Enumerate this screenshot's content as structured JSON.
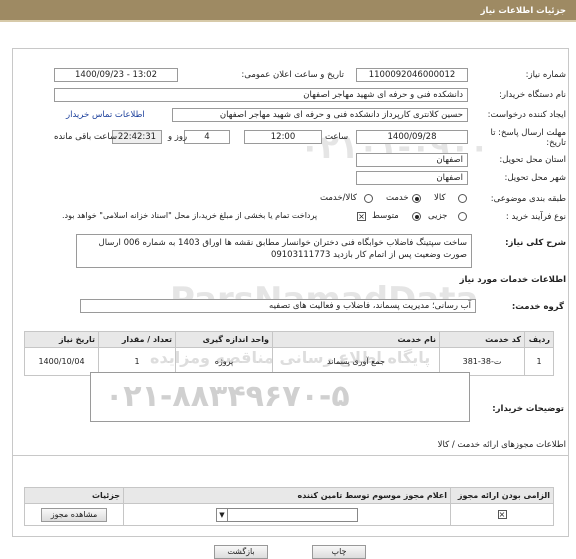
{
  "header": {
    "title": "جزئیات اطلاعات نیاز"
  },
  "need_number": {
    "label": "شماره نیاز:",
    "value": "1100092046000012"
  },
  "announce_datetime": {
    "label": "تاریخ و ساعت اعلان عمومی:",
    "value": "1400/09/23 - 13:02"
  },
  "buyer_org": {
    "label": "نام دستگاه خریدار:",
    "value": "دانشکده فنی و حرفه ای شهید مهاجر اصفهان"
  },
  "requester": {
    "label": "ایجاد کننده درخواست:",
    "value": "حسین کلانتری کارپرداز دانشکده فنی و حرفه ای شهید مهاجر اصفهان",
    "contact_link": "اطلاعات تماس خریدار"
  },
  "deadline": {
    "label": "مهلت ارسال پاسخ: تا تاریخ:",
    "date": "1400/09/28",
    "time_label": "ساعت",
    "time": "12:00",
    "days": "4",
    "days_label": "روز و",
    "remaining": "22:42:31",
    "remaining_label": "ساعت باقی مانده"
  },
  "province": {
    "label": "استان محل تحویل:",
    "value": "اصفهان"
  },
  "city": {
    "label": "شهر محل تحویل:",
    "value": "اصفهان"
  },
  "category": {
    "label": "طبقه بندی موضوعی:",
    "options": [
      "کالا",
      "خدمت",
      "کالا/خدمت"
    ],
    "selected": "خدمت"
  },
  "process": {
    "label": "نوع فرآیند خرید :",
    "options": [
      "جزیی",
      "متوسط"
    ],
    "selected": "متوسط",
    "treasury_note": "پرداخت تمام یا بخشی از مبلغ خرید،از محل \"اسناد خزانه اسلامی\" خواهد بود."
  },
  "summary": {
    "label": "شرح کلی نیاز:",
    "line1": "ساخت سپتینگ فاضلاب خوابگاه فنی دختران خوانسار مطابق نقشه ها  اوراق 1403 به شماره 006  ارسال",
    "line2": "صورت وضعیت پس از اتمام  کار  بازدید 09103111773"
  },
  "services_section": {
    "title": "اطلاعات خدمات مورد نیاز"
  },
  "service_group": {
    "label": "گروه خدمت:",
    "value": "آب رسانی؛ مدیریت پسماند، فاضلاب و فعالیت های تصفیه"
  },
  "services_table": {
    "headers": [
      "ردیف",
      "کد خدمت",
      "نام خدمت",
      "واحد اندازه گیری",
      "تعداد / مقدار",
      "تاریخ نیاز"
    ],
    "rows": [
      [
        "1",
        "ت-38-381",
        "جمع آوری پسماند",
        "پروژه",
        "1",
        "1400/10/04"
      ]
    ]
  },
  "buyer_notes": {
    "label": "توضیحات خریدار:",
    "watermark_phone": "۰۲۱-۸۸۳۴۹۶۷۰-۵"
  },
  "watermark": {
    "brand": "ParsNamadData",
    "phone_top": "۰۲۱۰۱-۰۹۰۰",
    "site_text": "پایگاه اطلاع رسانی مناقصه ومزایده"
  },
  "permits_section": {
    "title": "اطلاعات مجوزهای ارائه خدمت / کالا",
    "headers": [
      "الزامی بودن ارائه مجوز",
      "اعلام مجوز موسوم توسط تامین کننده",
      "جزئیات"
    ],
    "view_button": "مشاهده مجوز"
  },
  "footer": {
    "back_button": "بازگشت",
    "print_button": "چاپ"
  }
}
